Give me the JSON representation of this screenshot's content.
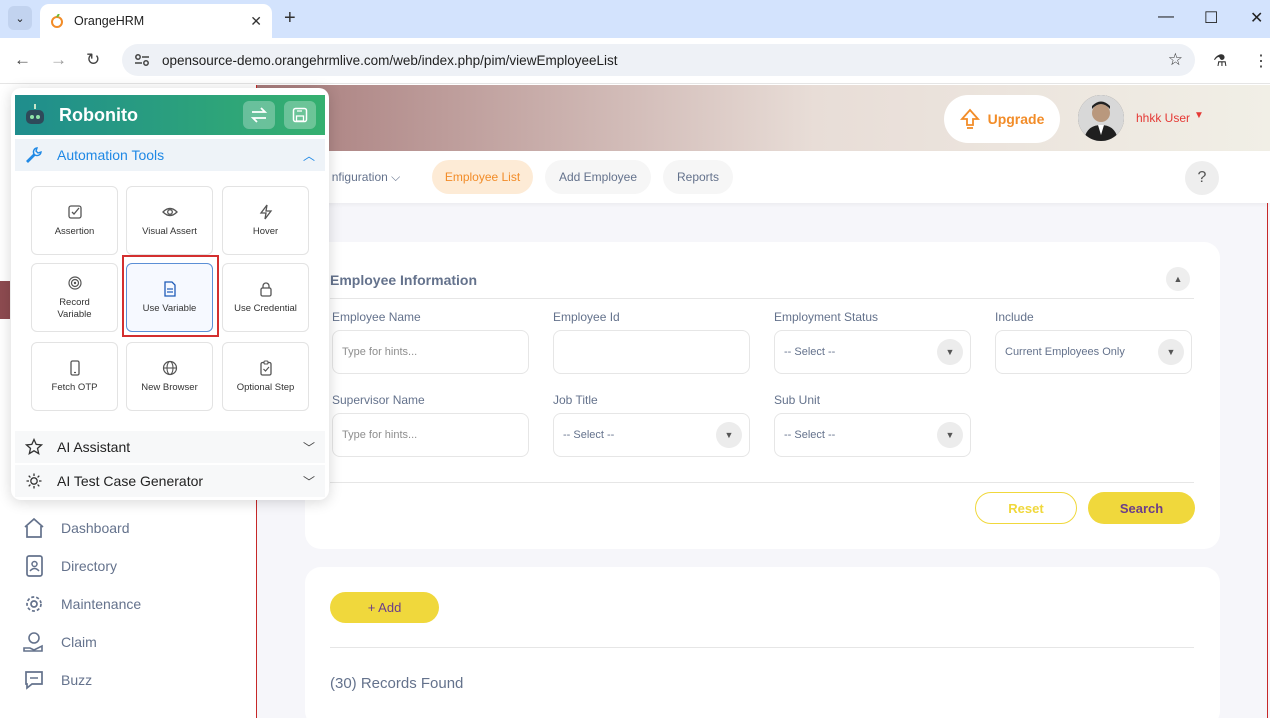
{
  "browser": {
    "tab_title": "OrangeHRM",
    "url": "opensource-demo.orangehrmlive.com/web/index.php/pim/viewEmployeeList"
  },
  "header": {
    "upgrade_label": "Upgrade",
    "user_name": "hhkk User"
  },
  "top_menu": [
    {
      "label": "nfiguration ⌵"
    },
    {
      "label": "Employee List"
    },
    {
      "label": "Add Employee"
    },
    {
      "label": "Reports"
    }
  ],
  "help_label": "?",
  "sidebar": {
    "items": [
      {
        "label": "Dashboard",
        "icon": "home-icon"
      },
      {
        "label": "Directory",
        "icon": "directory-icon"
      },
      {
        "label": "Maintenance",
        "icon": "maintenance-icon"
      },
      {
        "label": "Claim",
        "icon": "claim-icon"
      },
      {
        "label": "Buzz",
        "icon": "buzz-icon"
      }
    ]
  },
  "filter": {
    "title": "Employee Information",
    "fields": {
      "employee_name": {
        "label": "Employee Name",
        "placeholder": "Type for hints..."
      },
      "employee_id": {
        "label": "Employee Id",
        "value": ""
      },
      "employment_status": {
        "label": "Employment Status",
        "value": "-- Select --"
      },
      "include": {
        "label": "Include",
        "value": "Current Employees Only"
      },
      "supervisor_name": {
        "label": "Supervisor Name",
        "placeholder": "Type for hints..."
      },
      "job_title": {
        "label": "Job Title",
        "value": "-- Select --"
      },
      "sub_unit": {
        "label": "Sub Unit",
        "value": "-- Select --"
      }
    },
    "reset_label": "Reset",
    "search_label": "Search"
  },
  "results": {
    "add_label": "+ Add",
    "records_text": "(30) Records Found"
  },
  "robonito": {
    "title": "Robonito",
    "sections": {
      "automation": "Automation Tools",
      "ai_assistant": "AI Assistant",
      "ai_generator": "AI Test Case Generator"
    },
    "tools": [
      {
        "label": "Assertion",
        "icon": "check-square-icon"
      },
      {
        "label": "Visual Assert",
        "icon": "eye-icon"
      },
      {
        "label": "Hover",
        "icon": "lightning-icon"
      },
      {
        "label": "Record Variable",
        "icon": "target-icon"
      },
      {
        "label": "Use Variable",
        "icon": "document-icon"
      },
      {
        "label": "Use Credential",
        "icon": "lock-icon"
      },
      {
        "label": "Fetch OTP",
        "icon": "phone-icon"
      },
      {
        "label": "New Browser",
        "icon": "globe-icon"
      },
      {
        "label": "Optional Step",
        "icon": "clipboard-icon"
      }
    ]
  },
  "colors": {
    "accent_orange": "#f28c28",
    "button_yellow": "#f0d83c",
    "robonito_green": "#2ea57a",
    "highlight_red": "#d32f2f"
  }
}
